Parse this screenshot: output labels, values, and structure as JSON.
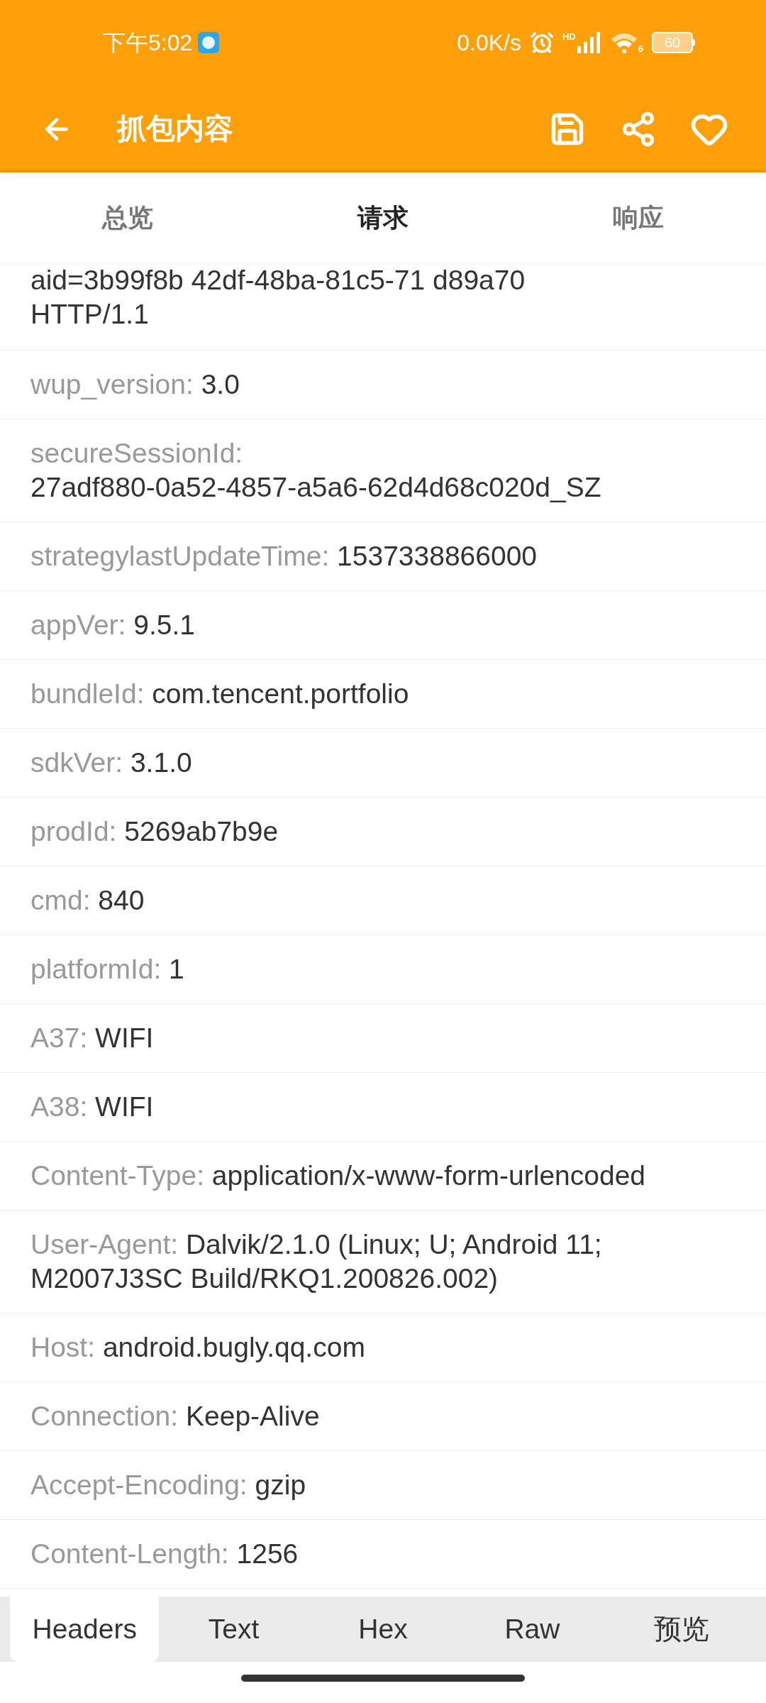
{
  "status_bar": {
    "time": "下午5:02",
    "net_speed": "0.0K/s",
    "network_label": "HD",
    "wifi_label": "6",
    "battery": "60"
  },
  "toolbar": {
    "title": "抓包内容"
  },
  "tabs": [
    {
      "label": "总览",
      "selected": false
    },
    {
      "label": "请求",
      "selected": true
    },
    {
      "label": "响应",
      "selected": false
    }
  ],
  "headers": [
    {
      "value": "aid=3b99f8b  42df-48ba-81c5-71  d89a70\nHTTP/1.1"
    },
    {
      "name": "wup_version:",
      "value": "3.0"
    },
    {
      "name": "secureSessionId:",
      "value": "27adf880-0a52-4857-a5a6-62d4d68c020d_SZ",
      "wrap": true
    },
    {
      "name": "strategylastUpdateTime:",
      "value": "1537338866000"
    },
    {
      "name": "appVer:",
      "value": "9.5.1"
    },
    {
      "name": "bundleId:",
      "value": "com.tencent.portfolio"
    },
    {
      "name": "sdkVer:",
      "value": "3.1.0"
    },
    {
      "name": "prodId:",
      "value": "5269ab7b9e"
    },
    {
      "name": "cmd:",
      "value": "840"
    },
    {
      "name": "platformId:",
      "value": "1"
    },
    {
      "name": "A37:",
      "value": "WIFI"
    },
    {
      "name": "A38:",
      "value": "WIFI"
    },
    {
      "name": "Content-Type:",
      "value": "application/x-www-form-urlencoded"
    },
    {
      "name": "User-Agent:",
      "value": "Dalvik/2.1.0 (Linux; U; Android 11;",
      "continuation": "M2007J3SC Build/RKQ1.200826.002)"
    },
    {
      "name": "Host:",
      "value": "android.bugly.qq.com"
    },
    {
      "name": "Connection:",
      "value": "Keep-Alive"
    },
    {
      "name": "Accept-Encoding:",
      "value": "gzip"
    },
    {
      "name": "Content-Length:",
      "value": "1256"
    }
  ],
  "bottom_tabs": [
    {
      "label": "Headers",
      "selected": true
    },
    {
      "label": "Text",
      "selected": false
    },
    {
      "label": "Hex",
      "selected": false
    },
    {
      "label": "Raw",
      "selected": false
    },
    {
      "label": "预览",
      "selected": false
    }
  ]
}
